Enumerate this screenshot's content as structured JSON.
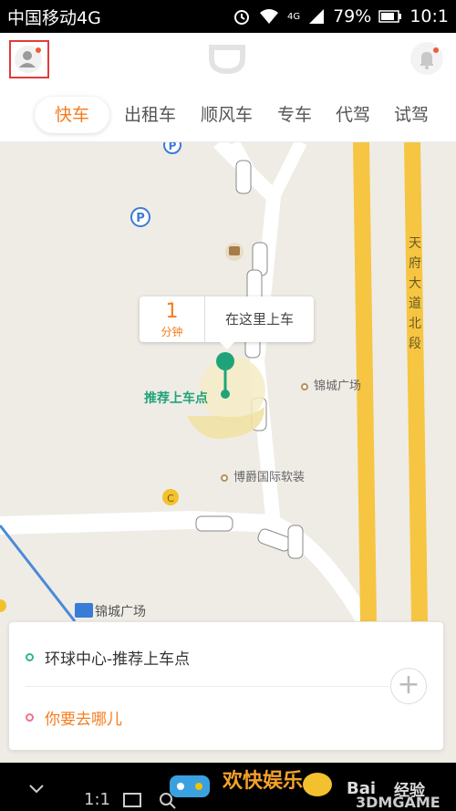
{
  "status_bar": {
    "carrier": "中国移动4G",
    "network_badge": "4G",
    "battery": "79%",
    "time": "10:1"
  },
  "header": {
    "avatar_icon": "user-avatar-icon",
    "logo_icon": "didi-logo-icon",
    "bell_icon": "bell-icon"
  },
  "tabs": [
    {
      "label": "快车"
    },
    {
      "label": "出租车"
    },
    {
      "label": "顺风车"
    },
    {
      "label": "专车"
    },
    {
      "label": "代驾"
    },
    {
      "label": "试驾"
    }
  ],
  "map": {
    "road_name": "天府大道北段",
    "poi_jincheng": "锦城广场",
    "poi_bojue": "博爵国际软装",
    "station_name": "锦城广场",
    "callout": {
      "eta_number": "1",
      "eta_unit": "分钟",
      "hint": "在这里上车"
    },
    "pickup_label": "推荐上车点"
  },
  "panel": {
    "pickup": "环球中心-推荐上车点",
    "destination_placeholder": "你要去哪儿",
    "add_label": "+"
  },
  "navbar": {
    "ratio": "1:1",
    "watermark_text": "欢快娱乐",
    "baidu": "Bai",
    "experience": "经验",
    "game": "3DMGAME"
  },
  "colors": {
    "accent": "#f57d1f",
    "pickup_green": "#1fa37a",
    "alert_red": "#e23b3b",
    "road_yellow": "#f6c542"
  }
}
